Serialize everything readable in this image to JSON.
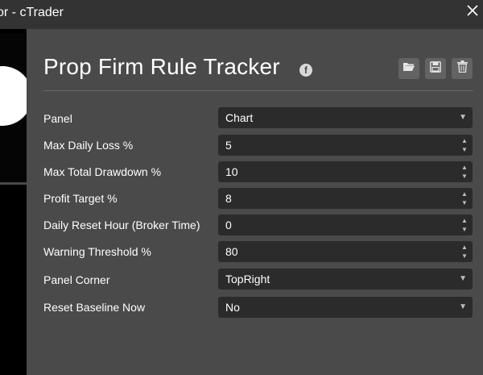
{
  "window": {
    "title": "or - cTrader"
  },
  "header": {
    "title": "Prop Firm Rule Tracker"
  },
  "fields": [
    {
      "label": "Panel",
      "value": "Chart",
      "control": "dropdown"
    },
    {
      "label": "Max Daily Loss %",
      "value": "5",
      "control": "spinner"
    },
    {
      "label": "Max Total Drawdown %",
      "value": "10",
      "control": "spinner"
    },
    {
      "label": "Profit Target %",
      "value": "8",
      "control": "spinner"
    },
    {
      "label": "Daily Reset Hour (Broker Time)",
      "value": "0",
      "control": "spinner"
    },
    {
      "label": "Warning Threshold %",
      "value": "80",
      "control": "spinner"
    },
    {
      "label": "Panel Corner",
      "value": "TopRight",
      "control": "dropdown"
    },
    {
      "label": "Reset Baseline Now",
      "value": "No",
      "control": "dropdown"
    }
  ],
  "icons": {
    "close": "close-icon",
    "facebook": "facebook-icon",
    "open": "folder-open-icon",
    "save": "save-icon",
    "delete": "trash-icon"
  },
  "colors": {
    "background": "#4a4a4a",
    "titlebar": "#333333",
    "field": "#2b2b2b"
  }
}
